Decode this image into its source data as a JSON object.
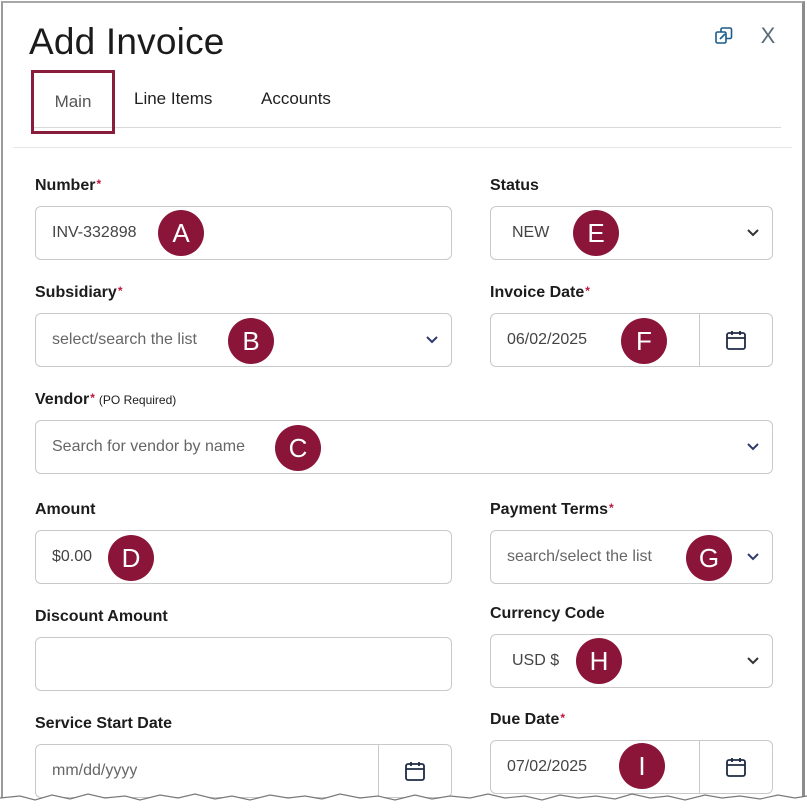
{
  "header": {
    "title": "Add Invoice",
    "popout_icon": "popout-icon",
    "close_label": "X"
  },
  "tabs": [
    {
      "label": "Main",
      "active": true
    },
    {
      "label": "Line Items"
    },
    {
      "label": "Accounts"
    }
  ],
  "fields": {
    "number": {
      "label": "Number",
      "required": "*",
      "value": "INV-332898",
      "marker": "A"
    },
    "status": {
      "label": "Status",
      "value": "NEW",
      "marker": "E"
    },
    "subsidiary": {
      "label": "Subsidiary",
      "required": "*",
      "placeholder": "select/search the list",
      "marker": "B"
    },
    "invoice_date": {
      "label": "Invoice Date",
      "required": "*",
      "value": "06/02/2025",
      "marker": "F"
    },
    "vendor": {
      "label": "Vendor",
      "required": "*",
      "note": "(PO Required)",
      "placeholder": "Search for vendor by name",
      "marker": "C"
    },
    "amount": {
      "label": "Amount",
      "value": "$0.00",
      "marker": "D"
    },
    "payment_terms": {
      "label": "Payment Terms",
      "required": "*",
      "placeholder": "search/select the list",
      "marker": "G"
    },
    "discount_amount": {
      "label": "Discount Amount",
      "value": ""
    },
    "currency_code": {
      "label": "Currency Code",
      "value": "USD $",
      "marker": "H"
    },
    "service_start_date": {
      "label": "Service Start Date",
      "placeholder": "mm/dd/yyyy"
    },
    "due_date": {
      "label": "Due Date",
      "required": "*",
      "value": "07/02/2025",
      "marker": "I"
    }
  },
  "colors": {
    "accent": "#8a1538",
    "required": "#c0153b",
    "border": "#c9c9c9"
  }
}
